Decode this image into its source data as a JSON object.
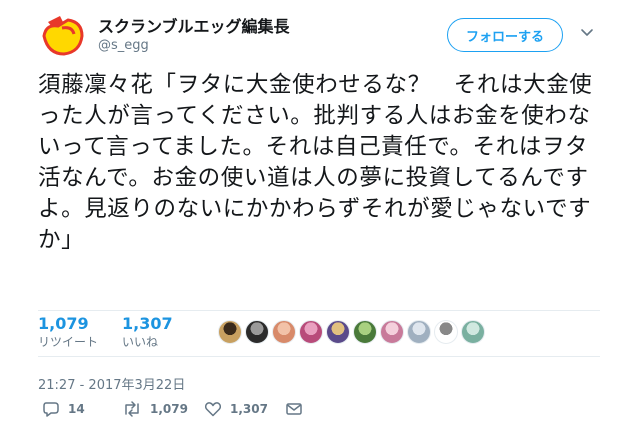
{
  "author": {
    "display_name": "スクランブルエッグ編集長",
    "handle": "@s_egg"
  },
  "follow_button": {
    "label": "フォローする"
  },
  "tweet": {
    "text": "須藤凜々花「ヲタに大金使わせるな？　それは大金使った人が言ってください。批判する人はお金を使わないって言ってました。それは自己責任で。それはヲタ活なんで。お金の使い道は人の夢に投資してるんですよ。見返りのないにかかわらずそれが愛じゃないですか」"
  },
  "stats": {
    "retweets": {
      "count": "1,079",
      "label": "リツイート"
    },
    "likes": {
      "count": "1,307",
      "label": "いいね"
    }
  },
  "likers": [
    {
      "colors": [
        "#c8a060",
        "#3a2a1a"
      ]
    },
    {
      "colors": [
        "#2b2b2b",
        "#9a9a9a"
      ]
    },
    {
      "colors": [
        "#d88a6a",
        "#f2c2a8"
      ]
    },
    {
      "colors": [
        "#b84b7a",
        "#e9a0c0"
      ]
    },
    {
      "colors": [
        "#5a4a8a",
        "#e0c080"
      ]
    },
    {
      "colors": [
        "#4a7a3a",
        "#a8d080"
      ]
    },
    {
      "colors": [
        "#c87a9a",
        "#f4d0dc"
      ]
    },
    {
      "colors": [
        "#a0b0c0",
        "#dfe6ee"
      ]
    },
    {
      "colors": [
        "#ffffff",
        "#888888"
      ]
    },
    {
      "colors": [
        "#7ab0a0",
        "#d0e8e0"
      ]
    }
  ],
  "timestamp": "21:27 - 2017年3月22日",
  "actions": {
    "reply_count": "14",
    "retweet_count": "1,079",
    "like_count": "1,307"
  },
  "icons": {
    "avatar": "egg-logo",
    "chevron": "chevron-down-icon",
    "reply": "reply-icon",
    "retweet": "retweet-icon",
    "like": "heart-icon",
    "dm": "envelope-icon"
  },
  "colors": {
    "accent": "#1da1f2",
    "stat": "#1c94e0",
    "muted": "#657786",
    "logo_yellow": "#ffd800",
    "logo_red": "#e8382a"
  }
}
